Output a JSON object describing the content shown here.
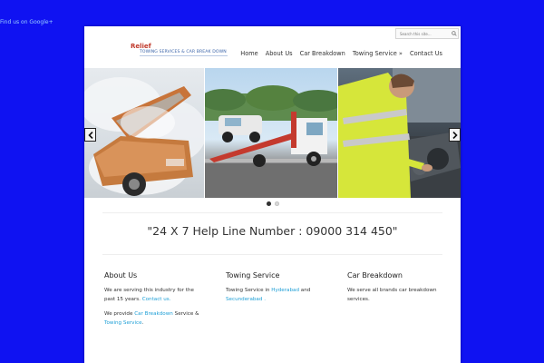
{
  "google_link": "Find us on Google+",
  "header": {
    "search_placeholder": "Search this site...",
    "logo_title": "Relief",
    "logo_tagline": "TOWING SERVICES & CAR BREAK DOWN",
    "nav": [
      "Home",
      "About Us",
      "Car Breakdown",
      "Towing Service »",
      "Contact Us"
    ]
  },
  "slider": {
    "dots_count": 2,
    "active_dot": 0
  },
  "helpline": "\"24 X 7 Help Line Number : 09000 314 450\"",
  "columns": {
    "about": {
      "title": "About Us",
      "p1_text": "We are serving this industry for the past 15 years.",
      "p1_link": "Contact us.",
      "p2_prefix": "We provide",
      "p2_link1": "Car Breakdown",
      "p2_mid": "Service &",
      "p2_link2": "Towing Service",
      "p2_suffix": "."
    },
    "towing": {
      "title": "Towing Service",
      "prefix": "Towing Service in",
      "link1": "Hyderabad",
      "mid": "and",
      "link2": "Secunderabad",
      "suffix": "."
    },
    "breakdown": {
      "title": "Car Breakdown",
      "text": "We serve all brands car breakdown services."
    }
  },
  "colors": {
    "page_bg": "#0f12f2",
    "link": "#1e9fd6",
    "logo_red": "#c0392b",
    "logo_blue": "#3a63a8"
  }
}
